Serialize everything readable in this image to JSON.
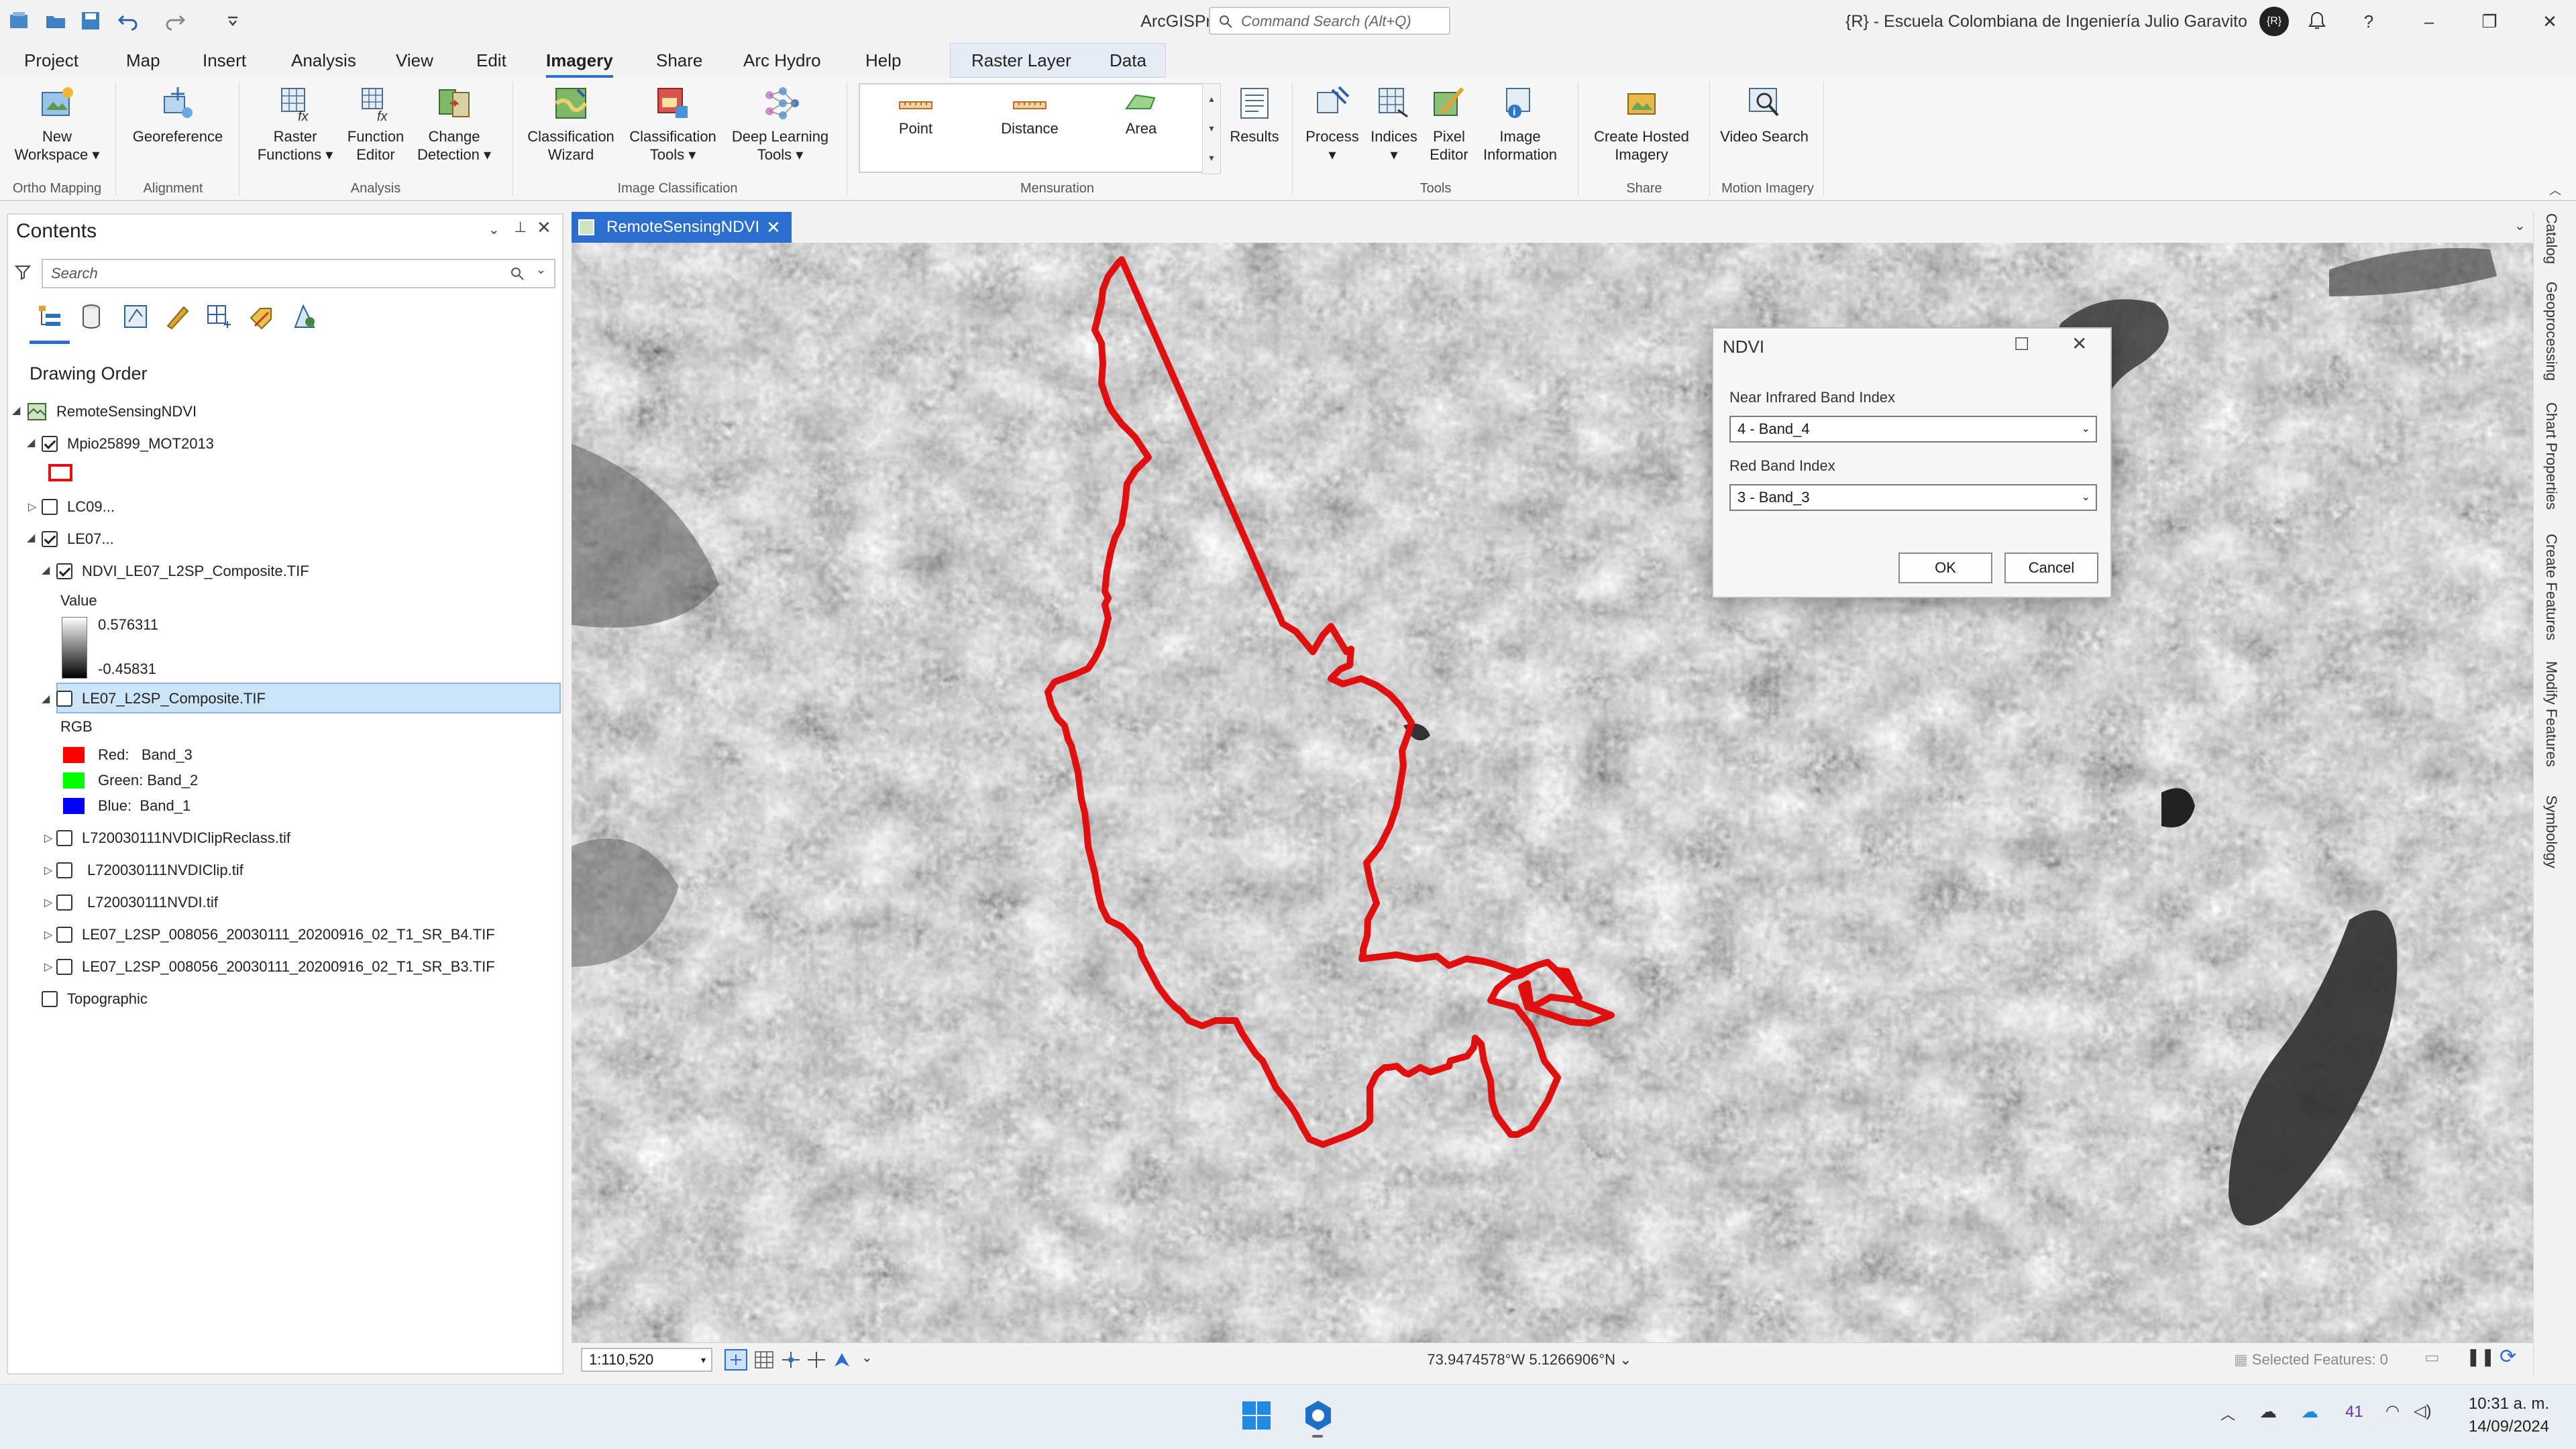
{
  "titlebar": {
    "app_title": "ArcGISPro",
    "search_placeholder": "Command Search (Alt+Q)",
    "org": "{R} - Escuela Colombiana de Ingeniería Julio Garavito",
    "avatar": "{R}"
  },
  "menu_tabs": [
    "Project",
    "Map",
    "Insert",
    "Analysis",
    "View",
    "Edit",
    "Imagery",
    "Share",
    "Arc Hydro",
    "Help"
  ],
  "context_tabs": [
    "Raster Layer",
    "Data"
  ],
  "active_tab": "Imagery",
  "ribbon": {
    "new_workspace": "New Workspace",
    "georeference": "Georeference",
    "raster_functions": "Raster Functions",
    "function_editor": "Function Editor",
    "change_detection": "Change Detection",
    "classification_wizard": "Classification Wizard",
    "classification_tools": "Classification Tools",
    "deep_learning_tools": "Deep Learning Tools",
    "point": "Point",
    "distance": "Distance",
    "area": "Area",
    "results": "Results",
    "process": "Process",
    "indices": "Indices",
    "pixel_editor": "Pixel Editor",
    "image_information": "Image Information",
    "create_hosted_imagery": "Create Hosted Imagery",
    "video_search": "Video Search",
    "groups": {
      "ortho_mapping": "Ortho Mapping",
      "alignment": "Alignment",
      "analysis": "Analysis",
      "image_classification": "Image Classification",
      "mensuration": "Mensuration",
      "tools": "Tools",
      "share": "Share",
      "motion_imagery": "Motion Imagery"
    }
  },
  "contents": {
    "title": "Contents",
    "search_placeholder": "Search",
    "drawing_order": "Drawing Order",
    "map_name": "RemoteSensingNDVI",
    "layers": {
      "mpio": "Mpio25899_MOT2013",
      "lc09": "LC09...",
      "le07": "LE07...",
      "ndvi": "NDVI_LE07_L2SP_Composite.TIF",
      "value_label": "Value",
      "value_max": "0.576311",
      "value_min": "-0.45831",
      "composite": "LE07_L2SP_Composite.TIF",
      "rgb_label": "RGB",
      "red": "Red:",
      "red_band": "Band_3",
      "green": "Green: Band_2",
      "blue": "Blue:",
      "blue_band": "Band_1",
      "reclass": "L720030111NVDIClipReclass.tif",
      "clip": "L720030111NVDIClip.tif",
      "nvdi": "L720030111NVDI.tif",
      "b4": "LE07_L2SP_008056_20030111_20200916_02_T1_SR_B4.TIF",
      "b3": "LE07_L2SP_008056_20030111_20200916_02_T1_SR_B3.TIF",
      "topographic": "Topographic"
    }
  },
  "map_tab": "RemoteSensingNDVI",
  "status": {
    "scale": "1:110,520",
    "coords": "73.9474578°W 5.1266906°N",
    "selected": "Selected Features: 0"
  },
  "right_dock": [
    "Catalog",
    "Geoprocessing",
    "Chart Properties",
    "Create Features",
    "Modify Features",
    "Symbology"
  ],
  "dialog": {
    "title": "NDVI",
    "nir_label": "Near Infrared Band Index",
    "nir_value": "4 - Band_4",
    "red_label": "Red Band Index",
    "red_value": "3 - Band_3",
    "ok": "OK",
    "cancel": "Cancel"
  },
  "taskbar": {
    "weather": "41",
    "time": "10:31 a. m.",
    "date": "14/09/2024"
  },
  "colors": {
    "accent": "#2a6fcf",
    "boundary": "#e01010",
    "legend_red": "#ff0000",
    "legend_green": "#00ff00",
    "legend_blue": "#0000ff"
  }
}
